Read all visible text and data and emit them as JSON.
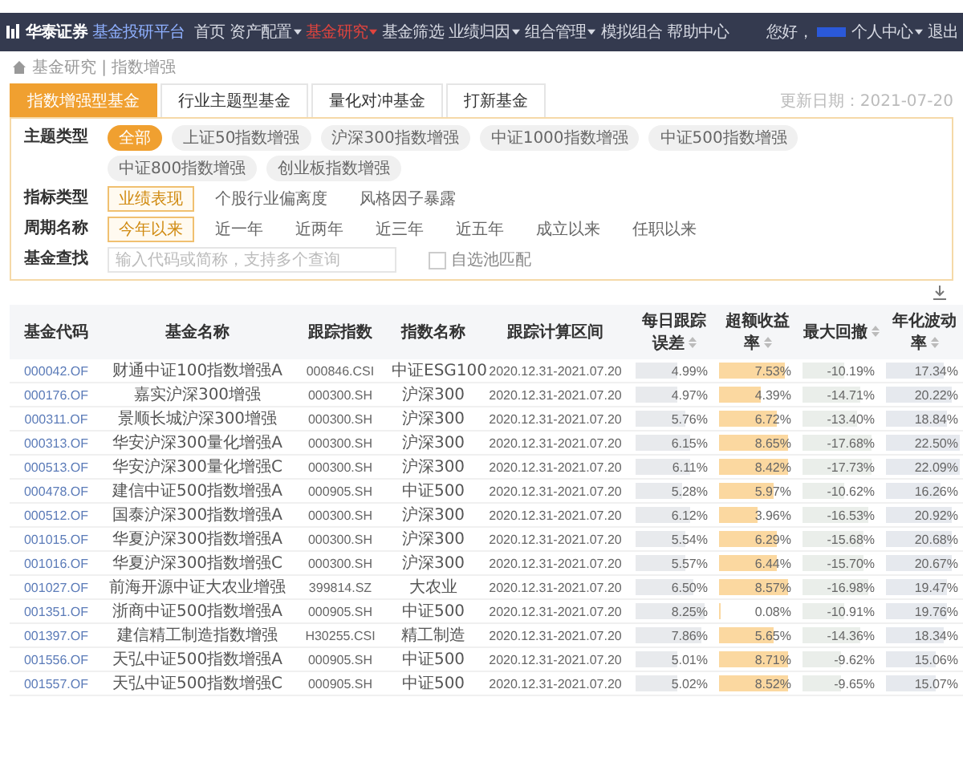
{
  "nav": {
    "logo": "华泰证券",
    "product": "基金投研平台",
    "items": [
      {
        "label": "首页",
        "selected": false,
        "menu": false
      },
      {
        "label": "资产配置",
        "selected": false,
        "menu": true
      },
      {
        "label": "基金研究",
        "selected": true,
        "menu": true
      },
      {
        "label": "基金筛选",
        "selected": false,
        "menu": false
      },
      {
        "label": "业绩归因",
        "selected": false,
        "menu": true
      },
      {
        "label": "组合管理",
        "selected": false,
        "menu": true
      },
      {
        "label": "模拟组合",
        "selected": false,
        "menu": false
      },
      {
        "label": "帮助中心",
        "selected": false,
        "menu": false
      }
    ],
    "greeting": "您好，",
    "user_menu": "个人中心",
    "logout": "退出"
  },
  "breadcrumb": "基金研究 | 指数增强",
  "tabs": [
    {
      "label": "指数增强型基金",
      "selected": true
    },
    {
      "label": "行业主题型基金",
      "selected": false
    },
    {
      "label": "量化对冲基金",
      "selected": false
    },
    {
      "label": "打新基金",
      "selected": false
    }
  ],
  "update_date": "更新日期：2021-07-20",
  "filters": [
    {
      "label": "主题类型",
      "kind": "pill",
      "options": [
        {
          "label": "全部",
          "selected": true
        },
        {
          "label": "上证50指数增强",
          "selected": false
        },
        {
          "label": "沪深300指数增强",
          "selected": false
        },
        {
          "label": "中证1000指数增强",
          "selected": false
        },
        {
          "label": "中证500指数增强",
          "selected": false
        },
        {
          "label": "中证800指数增强",
          "selected": false
        },
        {
          "label": "创业板指数增强",
          "selected": false
        }
      ]
    },
    {
      "label": "指标类型",
      "kind": "plain",
      "options": [
        {
          "label": "业绩表现",
          "selected": true
        },
        {
          "label": "个股行业偏离度",
          "selected": false
        },
        {
          "label": "风格因子暴露",
          "selected": false
        }
      ]
    },
    {
      "label": "周期名称",
      "kind": "plain",
      "options": [
        {
          "label": "今年以来",
          "selected": true
        },
        {
          "label": "近一年",
          "selected": false
        },
        {
          "label": "近两年",
          "selected": false
        },
        {
          "label": "近三年",
          "selected": false
        },
        {
          "label": "近五年",
          "selected": false
        },
        {
          "label": "成立以来",
          "selected": false
        },
        {
          "label": "任职以来",
          "selected": false
        }
      ]
    },
    {
      "label": "基金查找",
      "kind": "search",
      "placeholder": "输入代码或简称，支持多个查询",
      "checkbox": {
        "label": "自选池匹配",
        "checked": false
      }
    }
  ],
  "table": {
    "columns": [
      "基金代码",
      "基金名称",
      "跟踪指数",
      "指数名称",
      "跟踪计算区间",
      "每日跟踪误差",
      "超额收益率",
      "最大回撤",
      "年化波动率"
    ],
    "rows": [
      {
        "code": "000042.OF",
        "name": "财通中证100指数增强A",
        "index_code": "000846.CSI",
        "index_name": "中证ESG100",
        "period": "2020.12.31-2021.07.20",
        "te": {
          "text": "4.99%",
          "level": 0.55
        },
        "excess": {
          "text": "7.53%",
          "level": 0.85
        },
        "drawdown": {
          "text": "-10.19%",
          "level": 0.55
        },
        "vol": {
          "text": "17.34%",
          "level": 0.75
        }
      },
      {
        "code": "000176.OF",
        "name": "嘉实沪深300增强",
        "index_code": "000300.SH",
        "index_name": "沪深300",
        "period": "2020.12.31-2021.07.20",
        "te": {
          "text": "4.97%",
          "level": 0.55
        },
        "excess": {
          "text": "4.39%",
          "level": 0.55
        },
        "drawdown": {
          "text": "-14.71%",
          "level": 0.75
        },
        "vol": {
          "text": "20.22%",
          "level": 0.85
        }
      },
      {
        "code": "000311.OF",
        "name": "景顺长城沪深300增强",
        "index_code": "000300.SH",
        "index_name": "沪深300",
        "period": "2020.12.31-2021.07.20",
        "te": {
          "text": "5.76%",
          "level": 0.65
        },
        "excess": {
          "text": "6.72%",
          "level": 0.75
        },
        "drawdown": {
          "text": "-13.40%",
          "level": 0.7
        },
        "vol": {
          "text": "18.84%",
          "level": 0.8
        }
      },
      {
        "code": "000313.OF",
        "name": "华安沪深300量化增强A",
        "index_code": "000300.SH",
        "index_name": "沪深300",
        "period": "2020.12.31-2021.07.20",
        "te": {
          "text": "6.15%",
          "level": 0.7
        },
        "excess": {
          "text": "8.65%",
          "level": 0.9
        },
        "drawdown": {
          "text": "-17.68%",
          "level": 0.9
        },
        "vol": {
          "text": "22.50%",
          "level": 0.95
        }
      },
      {
        "code": "000513.OF",
        "name": "华安沪深300量化增强C",
        "index_code": "000300.SH",
        "index_name": "沪深300",
        "period": "2020.12.31-2021.07.20",
        "te": {
          "text": "6.11%",
          "level": 0.7
        },
        "excess": {
          "text": "8.42%",
          "level": 0.9
        },
        "drawdown": {
          "text": "-17.73%",
          "level": 0.9
        },
        "vol": {
          "text": "22.09%",
          "level": 0.95
        }
      },
      {
        "code": "000478.OF",
        "name": "建信中证500指数增强A",
        "index_code": "000905.SH",
        "index_name": "中证500",
        "period": "2020.12.31-2021.07.20",
        "te": {
          "text": "5.28%",
          "level": 0.6
        },
        "excess": {
          "text": "5.97%",
          "level": 0.7
        },
        "drawdown": {
          "text": "-10.62%",
          "level": 0.55
        },
        "vol": {
          "text": "16.26%",
          "level": 0.7
        }
      },
      {
        "code": "000512.OF",
        "name": "国泰沪深300指数增强A",
        "index_code": "000300.SH",
        "index_name": "沪深300",
        "period": "2020.12.31-2021.07.20",
        "te": {
          "text": "6.12%",
          "level": 0.7
        },
        "excess": {
          "text": "3.96%",
          "level": 0.5
        },
        "drawdown": {
          "text": "-16.53%",
          "level": 0.85
        },
        "vol": {
          "text": "20.92%",
          "level": 0.85
        }
      },
      {
        "code": "001015.OF",
        "name": "华夏沪深300指数增强A",
        "index_code": "000300.SH",
        "index_name": "沪深300",
        "period": "2020.12.31-2021.07.20",
        "te": {
          "text": "5.54%",
          "level": 0.65
        },
        "excess": {
          "text": "6.29%",
          "level": 0.75
        },
        "drawdown": {
          "text": "-15.68%",
          "level": 0.8
        },
        "vol": {
          "text": "20.68%",
          "level": 0.85
        }
      },
      {
        "code": "001016.OF",
        "name": "华夏沪深300指数增强C",
        "index_code": "000300.SH",
        "index_name": "沪深300",
        "period": "2020.12.31-2021.07.20",
        "te": {
          "text": "5.57%",
          "level": 0.65
        },
        "excess": {
          "text": "6.44%",
          "level": 0.75
        },
        "drawdown": {
          "text": "-15.70%",
          "level": 0.8
        },
        "vol": {
          "text": "20.67%",
          "level": 0.85
        }
      },
      {
        "code": "001027.OF",
        "name": "前海开源中证大农业增强",
        "index_code": "399814.SZ",
        "index_name": "大农业",
        "period": "2020.12.31-2021.07.20",
        "te": {
          "text": "6.50%",
          "level": 0.75
        },
        "excess": {
          "text": "8.57%",
          "level": 0.9
        },
        "drawdown": {
          "text": "-16.98%",
          "level": 0.85
        },
        "vol": {
          "text": "19.47%",
          "level": 0.8
        }
      },
      {
        "code": "001351.OF",
        "name": "浙商中证500指数增强A",
        "index_code": "000905.SH",
        "index_name": "中证500",
        "period": "2020.12.31-2021.07.20",
        "te": {
          "text": "8.25%",
          "level": 0.9
        },
        "excess": {
          "text": "0.08%",
          "level": 0.02
        },
        "drawdown": {
          "text": "-10.91%",
          "level": 0.55
        },
        "vol": {
          "text": "19.76%",
          "level": 0.8
        }
      },
      {
        "code": "001397.OF",
        "name": "建信精工制造指数增强",
        "index_code": "H30255.CSI",
        "index_name": "精工制造",
        "period": "2020.12.31-2021.07.20",
        "te": {
          "text": "7.86%",
          "level": 0.85
        },
        "excess": {
          "text": "5.65%",
          "level": 0.7
        },
        "drawdown": {
          "text": "-14.36%",
          "level": 0.75
        },
        "vol": {
          "text": "18.34%",
          "level": 0.75
        }
      },
      {
        "code": "001556.OF",
        "name": "天弘中证500指数增强A",
        "index_code": "000905.SH",
        "index_name": "中证500",
        "period": "2020.12.31-2021.07.20",
        "te": {
          "text": "5.01%",
          "level": 0.55
        },
        "excess": {
          "text": "8.71%",
          "level": 0.9
        },
        "drawdown": {
          "text": "-9.62%",
          "level": 0.5
        },
        "vol": {
          "text": "15.06%",
          "level": 0.65
        }
      },
      {
        "code": "001557.OF",
        "name": "天弘中证500指数增强C",
        "index_code": "000905.SH",
        "index_name": "中证500",
        "period": "2020.12.31-2021.07.20",
        "te": {
          "text": "5.02%",
          "level": 0.55
        },
        "excess": {
          "text": "8.52%",
          "level": 0.9
        },
        "drawdown": {
          "text": "-9.65%",
          "level": 0.5
        },
        "vol": {
          "text": "15.07%",
          "level": 0.65
        }
      }
    ]
  }
}
